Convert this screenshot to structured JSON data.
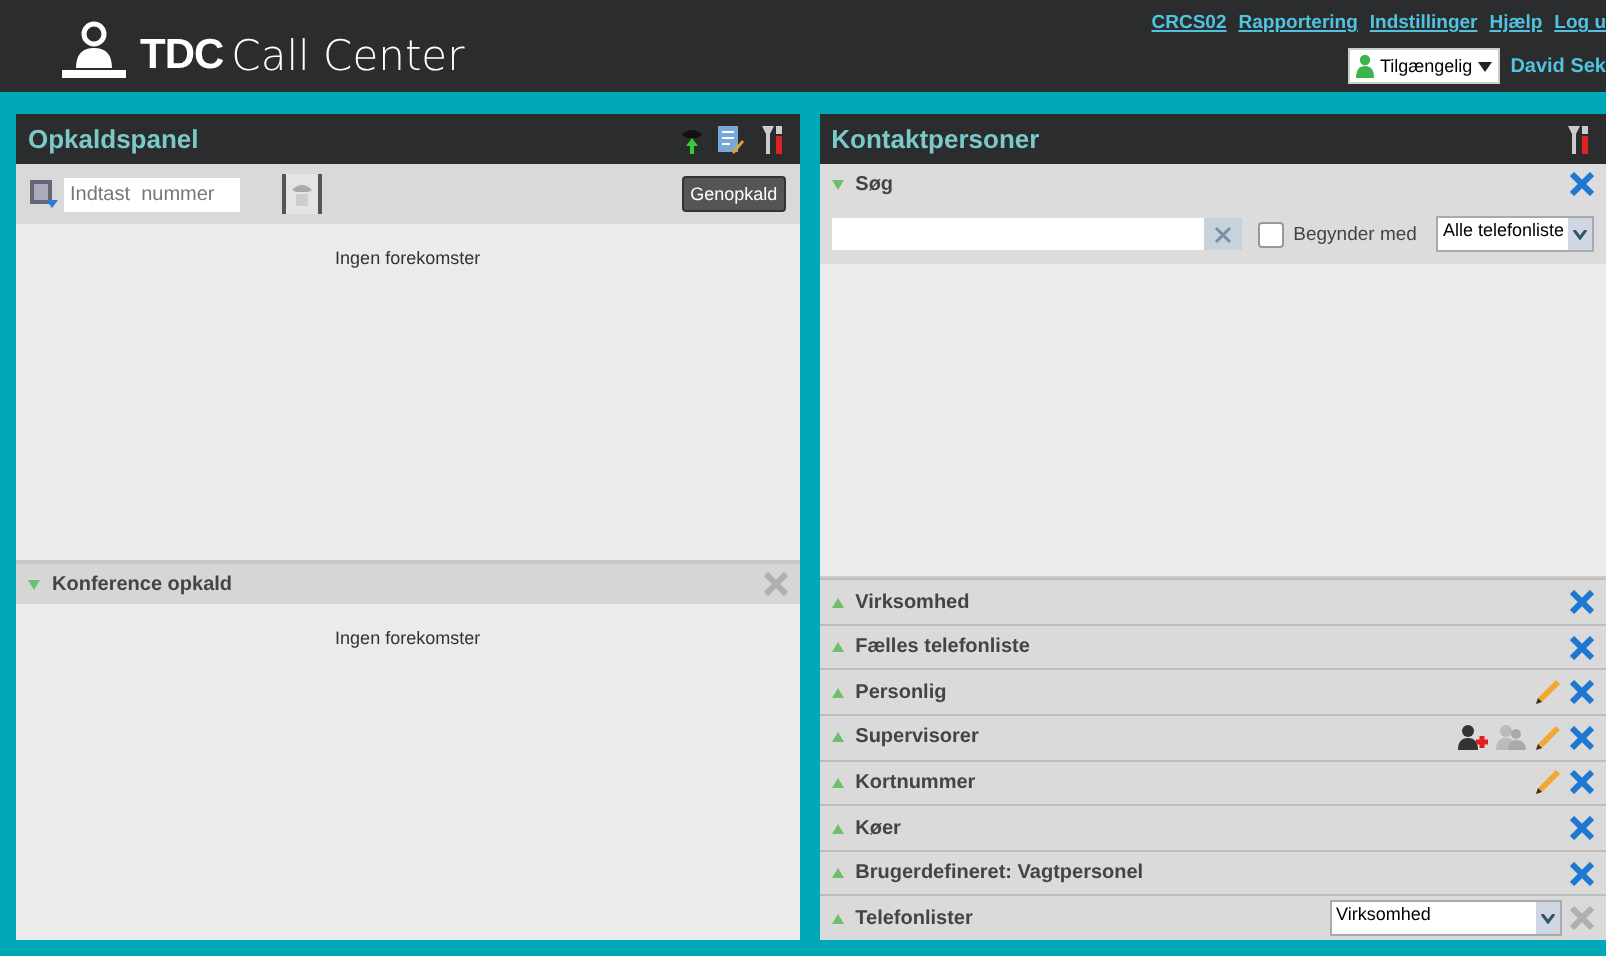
{
  "header": {
    "logo_text": "TDC",
    "logo_subtext": "Call Center",
    "links": [
      "CRCS02",
      "Rapportering",
      "Indstillinger",
      "Hjælp",
      "Log u"
    ],
    "status": "Tilgængelig",
    "user": "David Sek"
  },
  "call_panel": {
    "title": "Opkaldspanel",
    "number_placeholder": "Indtast  nummer",
    "redial_button": "Genopkald",
    "empty_text": "Ingen forekomster",
    "conference": {
      "title": "Konference opkald",
      "expanded": true,
      "close_enabled": false,
      "empty_text": "Ingen forekomster"
    }
  },
  "contacts_panel": {
    "title": "Kontaktpersoner",
    "search": {
      "title": "Søg",
      "expanded": true,
      "close_enabled": true,
      "starts_with_label": "Begynder med",
      "starts_with_checked": false,
      "directory": "Alle telefonliste"
    },
    "sections": [
      {
        "title": "Virksomhed",
        "expanded": false,
        "editable": false,
        "supervisor_tools": false,
        "close_enabled": true
      },
      {
        "title": "Fælles telefonliste",
        "expanded": false,
        "editable": false,
        "supervisor_tools": false,
        "close_enabled": true
      },
      {
        "title": "Personlig",
        "expanded": false,
        "editable": true,
        "supervisor_tools": false,
        "close_enabled": true
      },
      {
        "title": "Supervisorer",
        "expanded": false,
        "editable": true,
        "supervisor_tools": true,
        "close_enabled": true
      },
      {
        "title": "Kortnummer",
        "expanded": false,
        "editable": true,
        "supervisor_tools": false,
        "close_enabled": true
      },
      {
        "title": "Køer",
        "expanded": false,
        "editable": false,
        "supervisor_tools": false,
        "close_enabled": true
      },
      {
        "title": "Brugerdefineret: Vagtpersonel",
        "expanded": false,
        "editable": false,
        "supervisor_tools": false,
        "close_enabled": true
      },
      {
        "title": "Telefonlister",
        "expanded": false,
        "editable": false,
        "supervisor_tools": false,
        "close_enabled": false,
        "select_value": "Virksomhed"
      }
    ]
  }
}
